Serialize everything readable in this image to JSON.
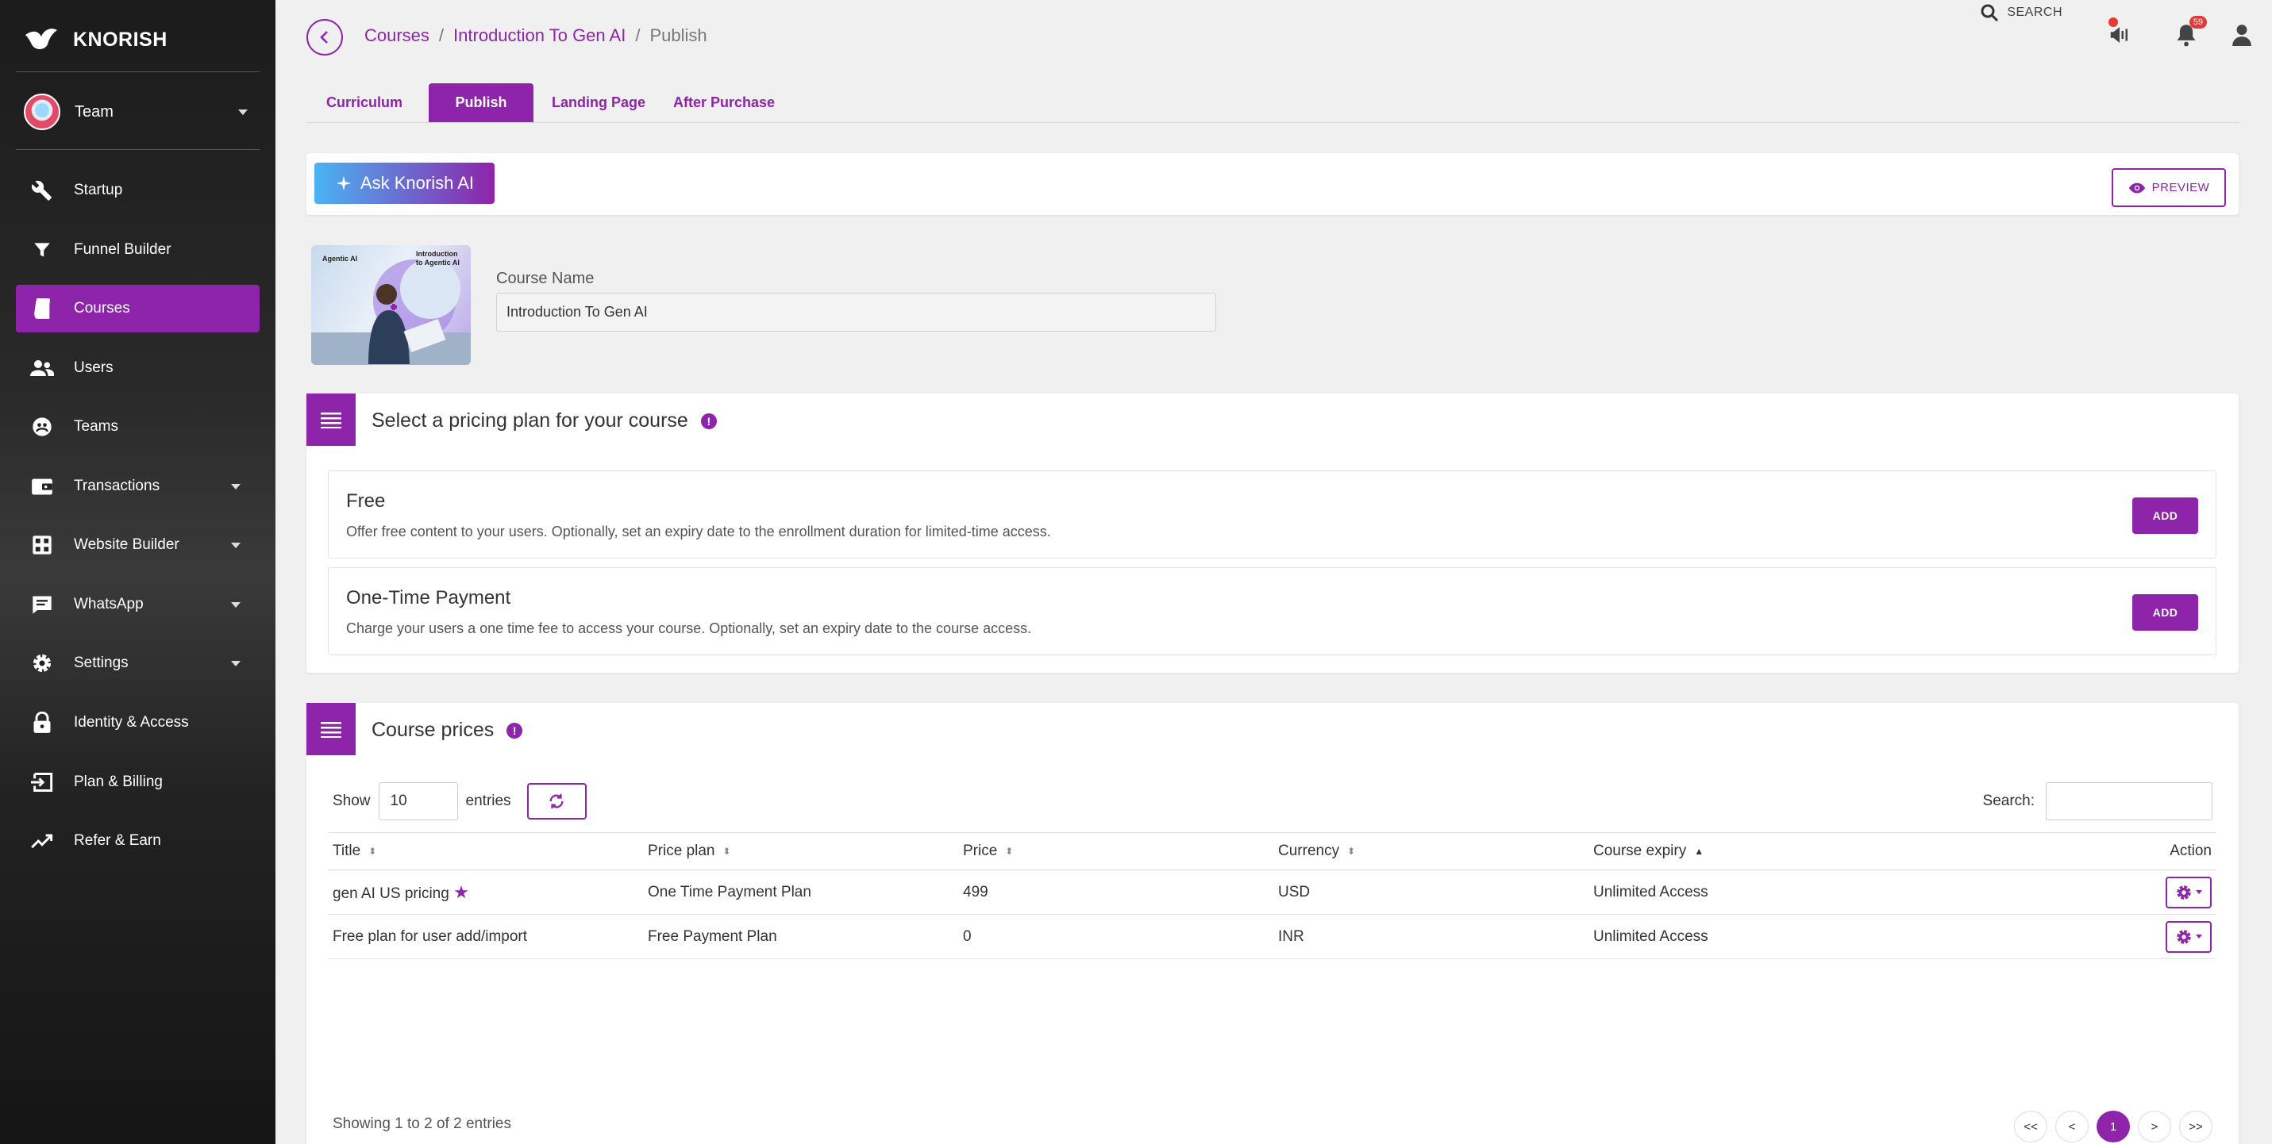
{
  "brand": {
    "name": "KNORISH"
  },
  "team": {
    "label": "Team"
  },
  "sidebar": {
    "items": [
      {
        "label": "Startup",
        "icon": "wrench-icon"
      },
      {
        "label": "Funnel Builder",
        "icon": "funnel-icon"
      },
      {
        "label": "Courses",
        "icon": "book-icon",
        "active": true
      },
      {
        "label": "Users",
        "icon": "users-icon"
      },
      {
        "label": "Teams",
        "icon": "teams-icon"
      },
      {
        "label": "Transactions",
        "icon": "wallet-icon"
      },
      {
        "label": "Website Builder",
        "icon": "grid-icon"
      },
      {
        "label": "WhatsApp",
        "icon": "chat-icon"
      },
      {
        "label": "Settings",
        "icon": "gear-icon"
      },
      {
        "label": "Identity & Access",
        "icon": "lock-icon"
      },
      {
        "label": "Plan & Billing",
        "icon": "billing-icon"
      },
      {
        "label": "Refer & Earn",
        "icon": "trend-icon"
      }
    ]
  },
  "breadcrumb": {
    "courses": "Courses",
    "course": "Introduction To Gen AI",
    "current": "Publish",
    "sep": "/"
  },
  "header": {
    "search_label": "SEARCH",
    "notification_count": "59"
  },
  "tabs": {
    "curriculum": "Curriculum",
    "publish": "Publish",
    "landing": "Landing Page",
    "after": "After Purchase"
  },
  "ai_bar": {
    "ask_label": "Ask Knorish AI",
    "preview_label": "PREVIEW"
  },
  "course": {
    "name_label": "Course Name",
    "name_value": "Introduction To Gen AI",
    "thumb_text_left": "Agentic AI",
    "thumb_text_right": "Introduction to Agentic AI"
  },
  "pricing": {
    "title": "Select a pricing plan for your course",
    "plans": [
      {
        "title": "Free",
        "desc": "Offer free content to your users. Optionally, set an expiry date to the enrollment duration for limited-time access.",
        "button": "ADD"
      },
      {
        "title": "One-Time Payment",
        "desc": "Charge your users a one time fee to access your course. Optionally, set an expiry date to the course access.",
        "button": "ADD"
      }
    ]
  },
  "prices": {
    "title": "Course prices",
    "show_label": "Show",
    "entries_value": "10",
    "entries_label": "entries",
    "search_label": "Search:",
    "columns": [
      "Title",
      "Price plan",
      "Price",
      "Currency",
      "Course expiry",
      "Action"
    ],
    "rows": [
      {
        "title": "gen AI US pricing",
        "plan": "One Time Payment Plan",
        "price": "499",
        "currency": "USD",
        "expiry": "Unlimited Access",
        "starred": true
      },
      {
        "title": "Free plan for user add/import",
        "plan": "Free Payment Plan",
        "price": "0",
        "currency": "INR",
        "expiry": "Unlimited Access",
        "starred": false
      }
    ],
    "footer": "Showing 1 to 2 of 2 entries",
    "pager": [
      "<<",
      "<",
      "1",
      ">",
      ">>"
    ]
  },
  "colors": {
    "accent": "#8e24aa",
    "sidebar_bg": "#1b1b1b",
    "badge": "#e53935"
  }
}
